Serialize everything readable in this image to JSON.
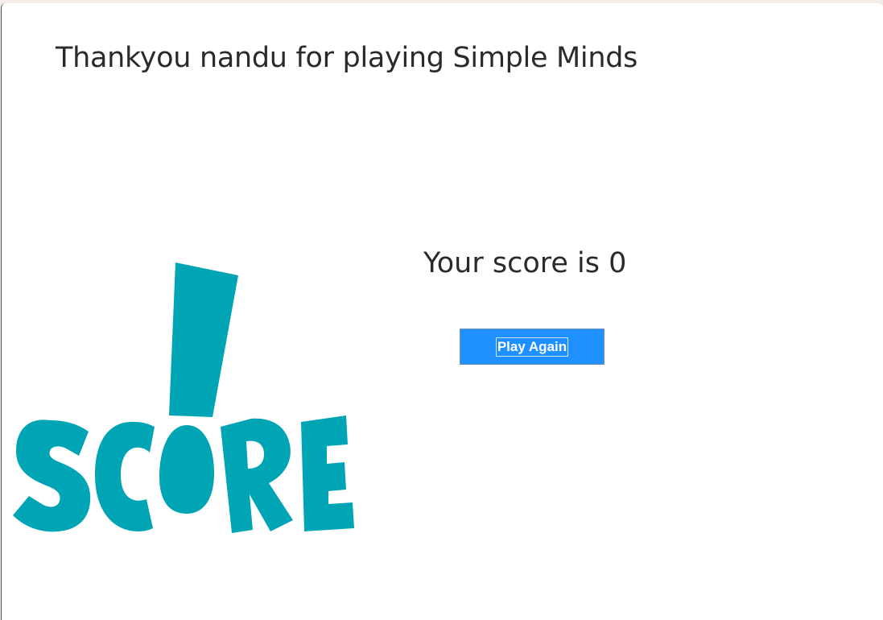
{
  "window": {
    "title_text": "Thankyou nandu for playing Simple Minds"
  },
  "result": {
    "score_text": "Your score is 0"
  },
  "actions": {
    "play_again_label": "Play Again"
  },
  "logo": {
    "text": "SCORE",
    "color": "#00a5b5"
  },
  "colors": {
    "button_bg": "#1e90ff",
    "text": "#2a2a2a",
    "background": "#ffffff"
  }
}
